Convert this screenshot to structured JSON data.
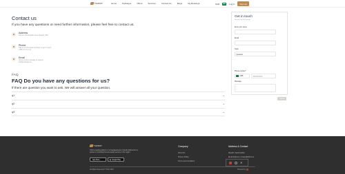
{
  "nav": {
    "logo_text": "THIBRT",
    "links": [
      "Home",
      "Packages",
      "Offers",
      "Services",
      "Contact Us",
      "Blogs",
      "My Bookings"
    ],
    "currency": "SAR",
    "login_label": "Log in",
    "signup_label": "Sign Up"
  },
  "contact": {
    "title": "Contact us",
    "intro": "If you have any questions or need further information, please feel free to contact us.",
    "items": [
      {
        "label": "Address",
        "sub": "Gurna 4 off Al Kathiri street Riyadh, KSA"
      },
      {
        "label": "Phone",
        "sub": "Call us on the below numbers to get in touch +966 xxx xxx xxx"
      },
      {
        "label": "Email",
        "sub": "Send us your message to support info@example.sa"
      }
    ]
  },
  "form": {
    "title": "Get in touch",
    "subtitle": "We will respond shortly",
    "name_label": "Enter your name",
    "email_label": "Email",
    "topic_label": "Topic",
    "topic_value": "Question",
    "phone_label": "Phone number*",
    "phone_code": "+966",
    "phone_placeholder": "5XXXXXXXX",
    "message_label": "Message",
    "submit_label": "Submit"
  },
  "faq": {
    "tag": "FAQ",
    "title": "FAQ Do you have any questions for us?",
    "subtitle": "If there are question you want to ask. We will answer all your question.",
    "questions": [
      "q1",
      "q2",
      "q3"
    ]
  },
  "footer": {
    "logo_text": "THIBRT",
    "description": "Thibrt a leading platform. It is headquartered in Saudi Arabia and is a pioneer in providing the best quality services in the region.",
    "app_store": "App Store",
    "google_play": "Google Play",
    "company_title": "Company",
    "company_links": [
      "About Us",
      "Privacy Policy",
      "Terms and Conditions"
    ],
    "contact_title": "Address & Contact",
    "contact_lines": [
      "Riyadh, Saudi Arabia",
      "Email Address: contact@thibrt.sa"
    ],
    "copyright": "All Rights Reserved © Thibrt 2024",
    "powered": "Powered by"
  }
}
